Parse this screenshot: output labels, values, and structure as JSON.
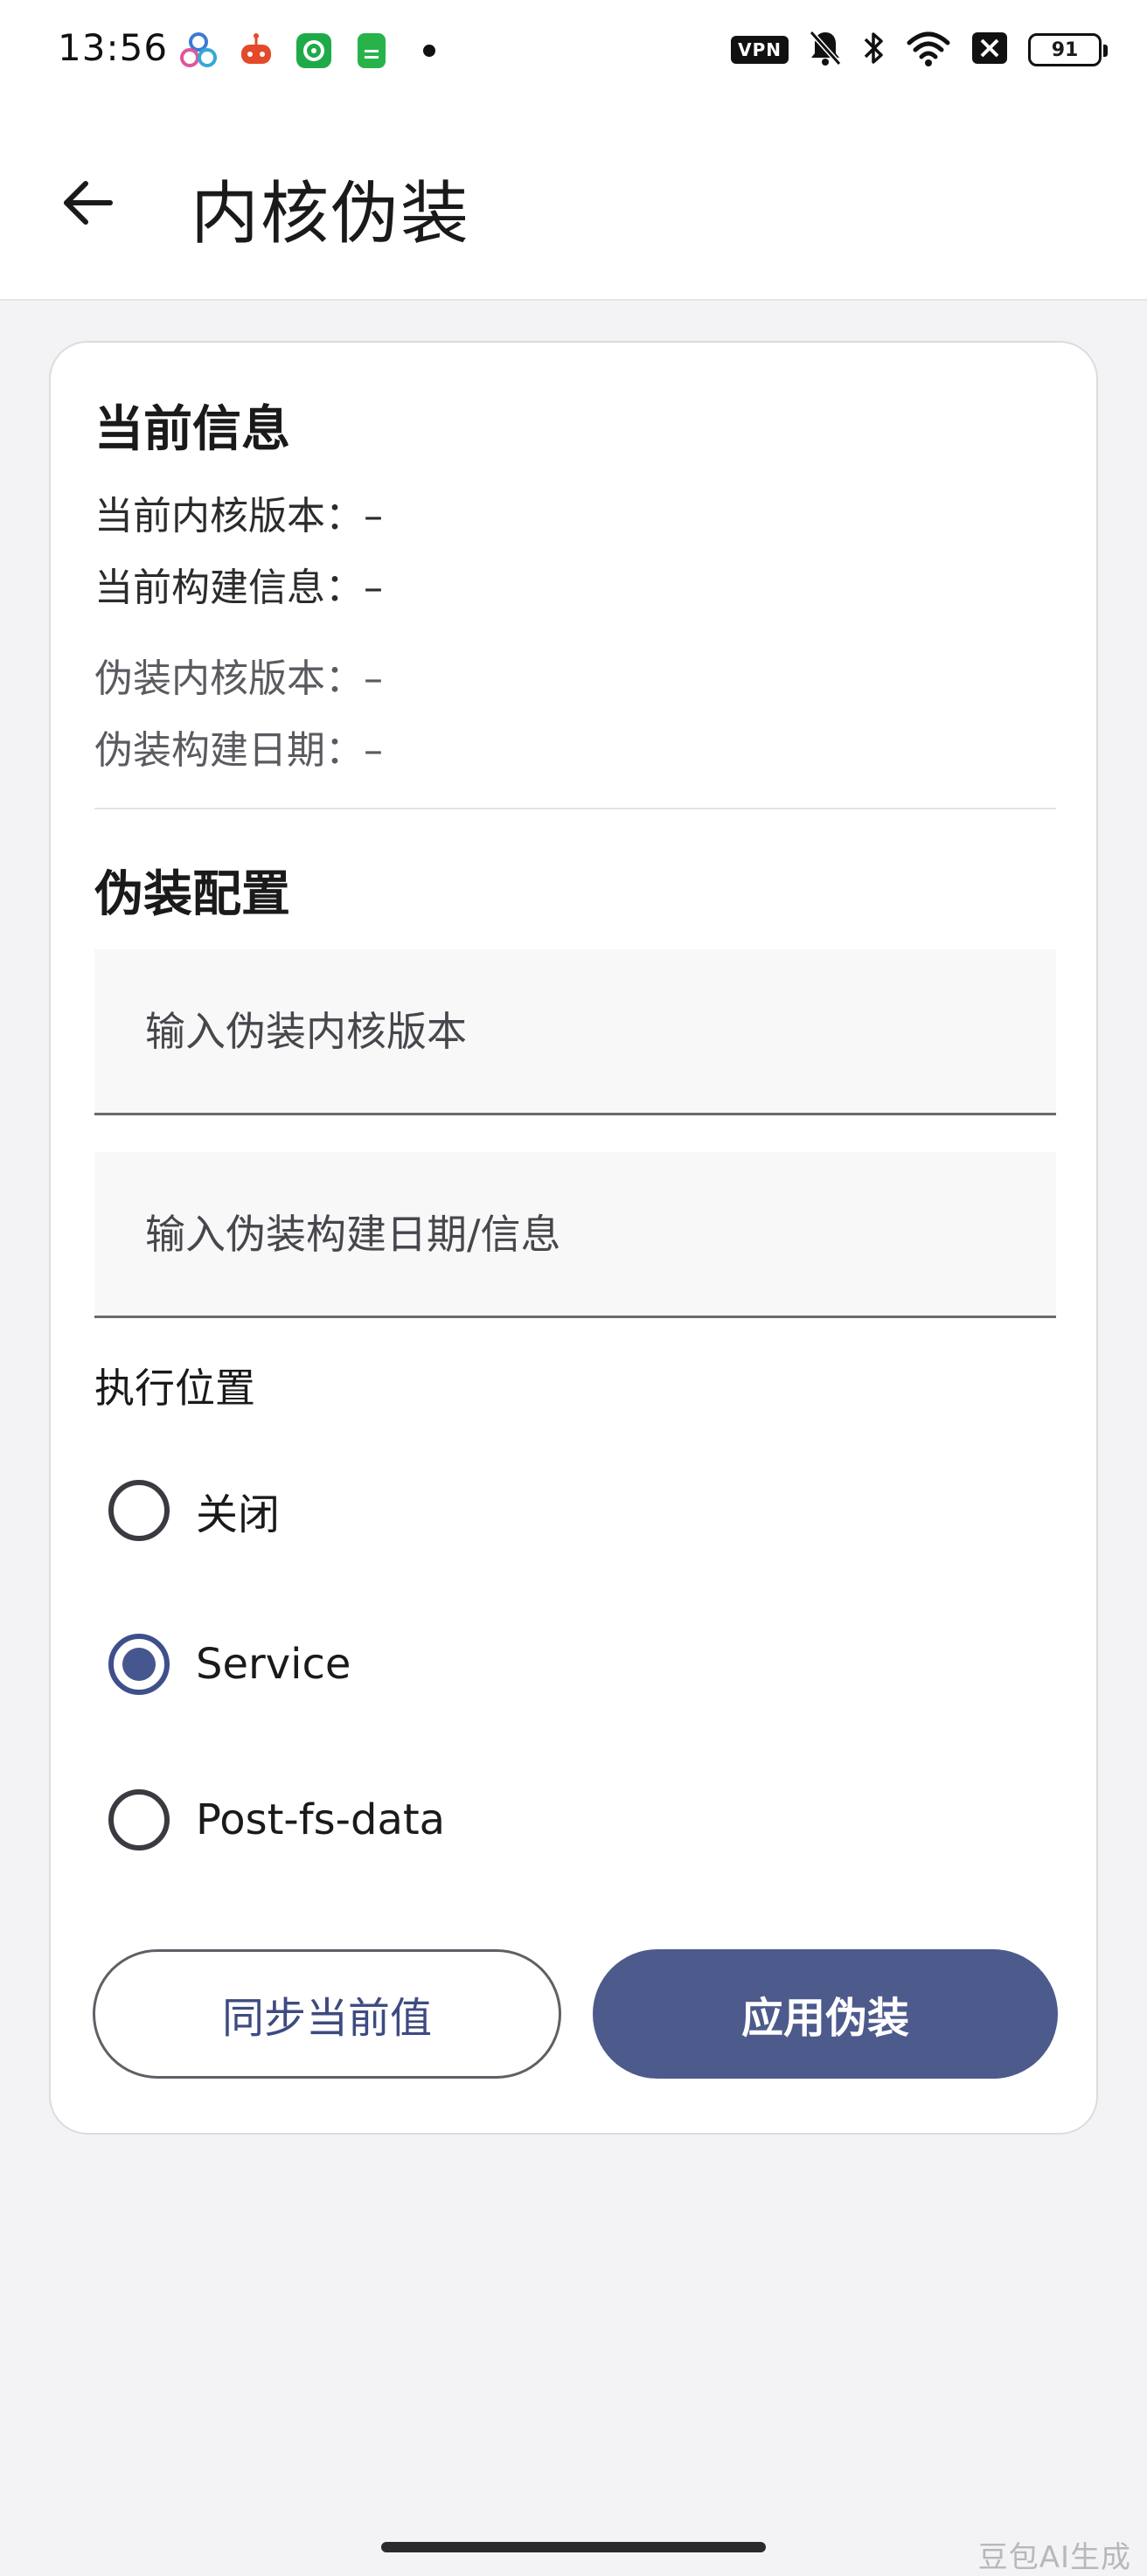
{
  "status_bar": {
    "time": "13:56",
    "left_icons": [
      "cluster-app-icon",
      "robot-app-icon",
      "shield-app-icon",
      "doc-app-icon",
      "dot-icon"
    ],
    "vpn": "VPN",
    "battery": "91"
  },
  "app_bar": {
    "title": "内核伪装"
  },
  "current_info": {
    "title": "当前信息",
    "kernel_version": "当前内核版本：–",
    "build_info": "当前构建信息：–",
    "spoof_kernel_version": "伪装内核版本：–",
    "spoof_build_date": "伪装构建日期：–"
  },
  "spoof_config": {
    "title": "伪装配置",
    "version_input": {
      "placeholder": "输入伪装内核版本",
      "value": ""
    },
    "build_input": {
      "placeholder": "输入伪装构建日期/信息",
      "value": ""
    },
    "exec_location_label": "执行位置",
    "options": [
      {
        "label": "关闭",
        "selected": false
      },
      {
        "label": "Service",
        "selected": true
      },
      {
        "label": "Post-fs-data",
        "selected": false
      }
    ]
  },
  "actions": {
    "sync_label": "同步当前值",
    "apply_label": "应用伪装"
  },
  "watermark": "豆包AI生成",
  "colors": {
    "accent": "#4d5a8c",
    "radio_selected": "#46578f",
    "background": "#f3f3f5"
  }
}
